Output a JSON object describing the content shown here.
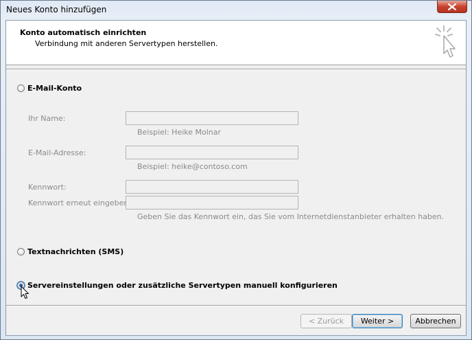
{
  "window": {
    "title": "Neues Konto hinzufügen"
  },
  "header": {
    "title": "Konto automatisch einrichten",
    "subtitle": "Verbindung mit anderen Servertypen herstellen."
  },
  "options": {
    "email": {
      "label": "E-Mail-Konto",
      "selected": false
    },
    "sms": {
      "label": "Textnachrichten (SMS)",
      "selected": false
    },
    "manual": {
      "label": "Servereinstellungen oder zusätzliche Servertypen manuell konfigurieren",
      "selected": true
    }
  },
  "form": {
    "name_label": "Ihr Name:",
    "name_value": "",
    "name_hint": "Beispiel: Heike Molnar",
    "email_label": "E-Mail-Adresse:",
    "email_value": "",
    "email_hint": "Beispiel: heike@contoso.com",
    "password_label": "Kennwort:",
    "password_value": "",
    "password_confirm_label": "Kennwort erneut eingeben:",
    "password_confirm_value": "",
    "password_hint": "Geben Sie das Kennwort ein, das Sie vom Internetdienstanbieter erhalten haben."
  },
  "buttons": {
    "back": "< Zurück",
    "next": "Weiter >",
    "cancel": "Abbrechen"
  },
  "icons": {
    "close": "close-icon",
    "wizard": "click-cursor-icon",
    "pointer": "mouse-pointer-icon"
  },
  "colors": {
    "accent": "#1c5fa8",
    "close": "#c7432f"
  }
}
